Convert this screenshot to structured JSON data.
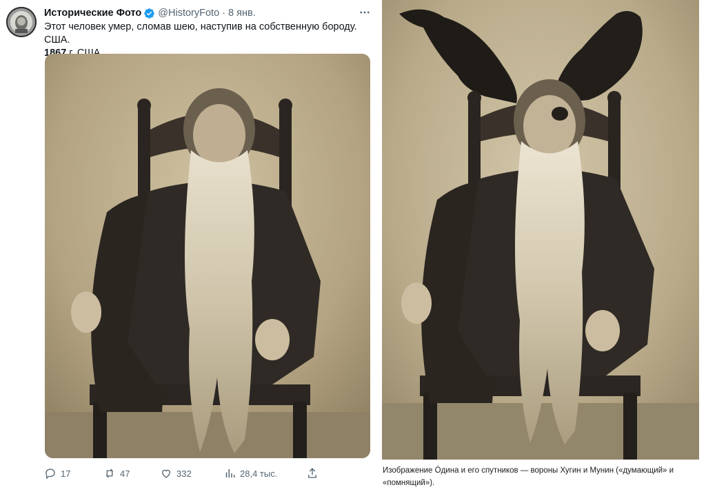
{
  "tweet": {
    "author_name": "Исторические Фото",
    "handle": "@HistoryFoto",
    "separator": "·",
    "date": "8 янв.",
    "text_line1": "Этот человек умер, сломав шею, наступив на собственную бороду. США.",
    "text_year": "1867",
    "text_line2_rest": " г. США.",
    "icons": {
      "avatar": "avatar",
      "verified": "verified-badge-icon",
      "more": "more-options-icon"
    },
    "actions": {
      "replies": "17",
      "reposts": "47",
      "likes": "332",
      "views": "28,4 тыс."
    },
    "colors": {
      "accent": "#1d9bf0",
      "muted": "#536471",
      "text": "#0f1419"
    }
  },
  "right_panel": {
    "caption": "Изображение Óдина и его спутников — вороны Хугин и Мунин («думающий» и «помнящий»)."
  }
}
